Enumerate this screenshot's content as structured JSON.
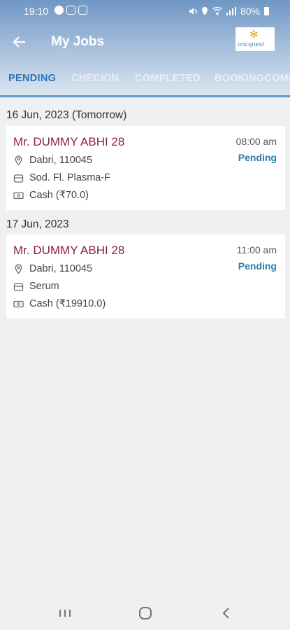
{
  "status_bar": {
    "time": "19:10",
    "battery": "80%"
  },
  "toolbar": {
    "title": "My Jobs",
    "logo_text": "oncquest"
  },
  "tabs": [
    {
      "label": "PENDING",
      "active": true
    },
    {
      "label": "CHECKIN",
      "active": false
    },
    {
      "label": "COMPLETED",
      "active": false
    },
    {
      "label": "BOOKINGCOMP",
      "active": false
    }
  ],
  "groups": [
    {
      "date": "16 Jun, 2023 (Tomorrow)",
      "job": {
        "patient": "Mr. DUMMY ABHI 28",
        "time": "08:00 am",
        "status": "Pending",
        "location": "Dabri, 110045",
        "sample": "Sod. Fl. Plasma-F",
        "payment": "Cash (₹70.0)"
      }
    },
    {
      "date": "17 Jun, 2023",
      "job": {
        "patient": "Mr. DUMMY ABHI 28",
        "time": "11:00 am",
        "status": "Pending",
        "location": "Dabri, 110045",
        "sample": "Serum",
        "payment": "Cash (₹19910.0)"
      }
    }
  ],
  "icons": {
    "back": "arrow-left-icon",
    "location": "location-pin-icon",
    "sample": "sample-tube-icon",
    "payment": "cash-icon"
  },
  "colors": {
    "patient_name": "#8b1e4d",
    "status": "#2c7fa8",
    "active_tab": "#2e73b8"
  }
}
